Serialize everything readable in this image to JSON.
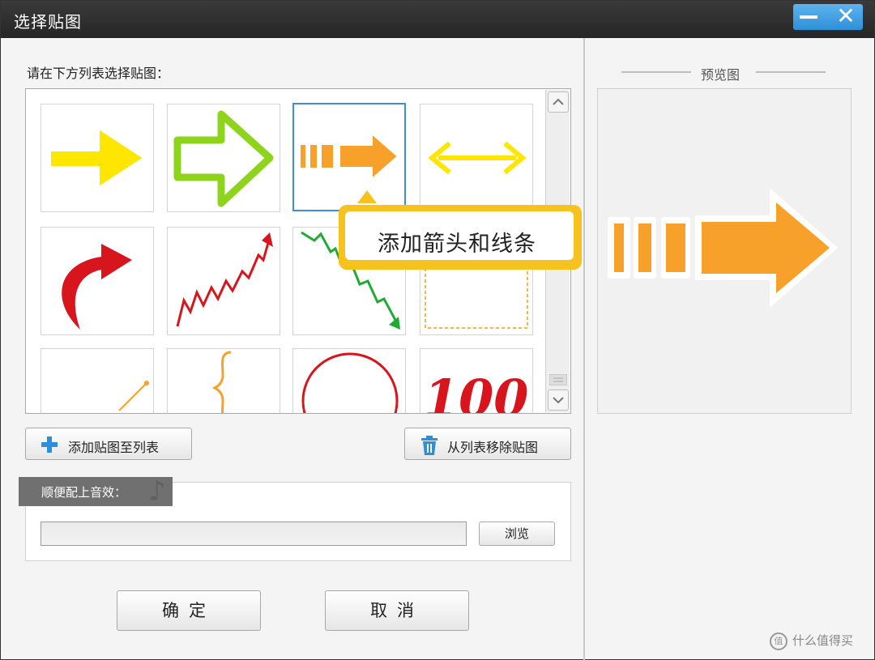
{
  "window": {
    "title": "选择贴图",
    "close_symbol": "✕"
  },
  "list": {
    "prompt": "请在下方列表选择贴图：",
    "tiles": [
      {
        "name": "yellow-arrow",
        "selected": false
      },
      {
        "name": "green-outline-arrow",
        "selected": false
      },
      {
        "name": "orange-striped-arrow",
        "selected": true
      },
      {
        "name": "yellow-double-arrow",
        "selected": false
      },
      {
        "name": "red-curved-arrow",
        "selected": false
      },
      {
        "name": "red-rising-line-arrow",
        "selected": false
      },
      {
        "name": "green-falling-line-arrow",
        "selected": false
      },
      {
        "name": "dashed-frame",
        "selected": false
      },
      {
        "name": "orange-line",
        "selected": false
      },
      {
        "name": "orange-brace",
        "selected": false
      },
      {
        "name": "red-circle",
        "selected": false
      },
      {
        "name": "red-100-text",
        "selected": false
      }
    ],
    "tooltip": "添加箭头和线条",
    "tile_100_text": "100"
  },
  "buttons": {
    "add_to_list": "添加贴图至列表",
    "remove_from_list": "从列表移除贴图",
    "browse": "浏览",
    "ok": "确定",
    "cancel": "取消"
  },
  "sound": {
    "label": "顺便配上音效：",
    "file_value": ""
  },
  "preview": {
    "title": "预览图"
  },
  "watermark": {
    "text": "什么值得买",
    "logo": "值"
  },
  "colors": {
    "title_bar": "#2e2e2e",
    "window_buttons": "#3b9be0",
    "selection": "#3c8fd6",
    "tooltip": "#f6c21d",
    "arrow_orange": "#f7a12a",
    "arrow_yellow": "#ffe600",
    "arrow_green": "#8fd41c",
    "red": "#d8141c"
  }
}
